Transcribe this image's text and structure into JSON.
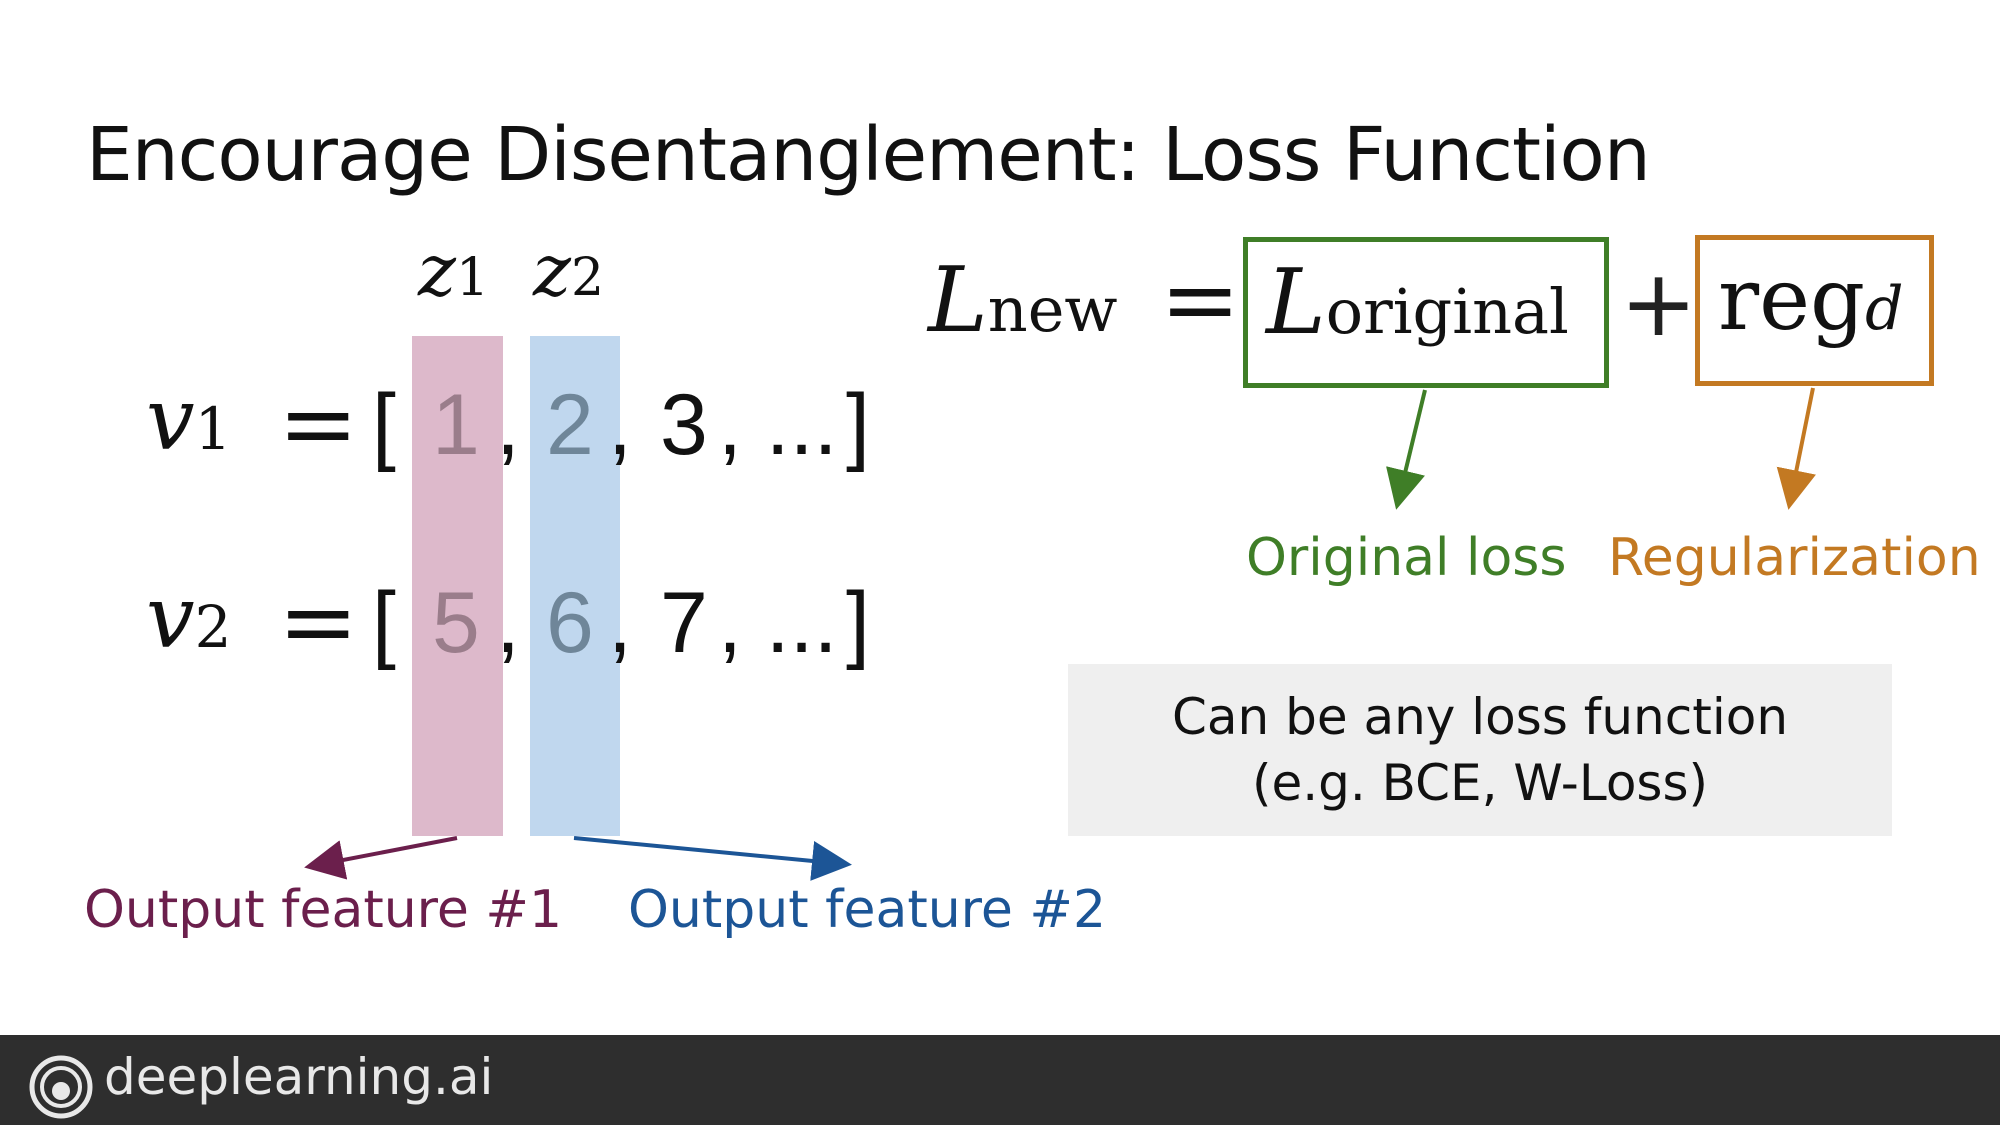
{
  "slide": {
    "title": "Encourage Disentanglement: Loss Function"
  },
  "latent": {
    "z1": {
      "base": "z",
      "sub": "1"
    },
    "z2": {
      "base": "z",
      "sub": "2"
    }
  },
  "vectors": [
    {
      "base": "v",
      "sub": "1",
      "eq": "=",
      "open": "[",
      "a": "1",
      "b": "2",
      "c": "3",
      "sep": ",",
      "rest": ", ...",
      "close": "]"
    },
    {
      "base": "v",
      "sub": "2",
      "eq": "=",
      "open": "[",
      "a": "5",
      "b": "6",
      "c": "7",
      "sep": ",",
      "rest": ", ...",
      "close": "]"
    }
  ],
  "formula": {
    "lhs_base": "L",
    "lhs_sub": "new",
    "eq": "=",
    "orig_base": "L",
    "orig_sub": "original",
    "plus": "+",
    "reg": "reg",
    "reg_sub": "d"
  },
  "labels": {
    "original_loss": "Original loss",
    "regularization": "Regularization",
    "output1": "Output feature #1",
    "output2": "Output feature #2"
  },
  "note": {
    "line1": "Can be any loss function",
    "line2": "(e.g. BCE, W-Loss)"
  },
  "footer": {
    "brand": "deeplearning.ai",
    "logo_icon": "deeplearning-logo-icon"
  },
  "colors": {
    "pink_band": "#ddb9cb",
    "blue_band": "#c0d7ee",
    "output1": "#6b1f4c",
    "output2": "#1c5596",
    "original_loss": "#3f7e27",
    "regularization": "#c37922",
    "footer_bg": "#2e2e2e"
  }
}
